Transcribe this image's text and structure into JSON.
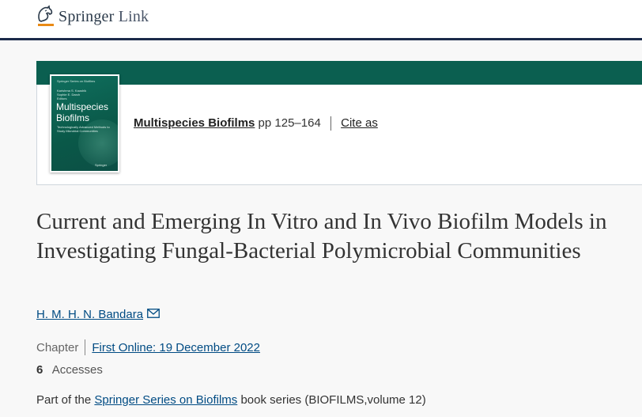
{
  "header": {
    "logo_word": "Springer",
    "logo_link": "Link",
    "logo_icon": "springer-horse-icon"
  },
  "book": {
    "cover": {
      "series": "Springer Series on Biofilms",
      "editors_line1": "Karishma S. Kaushik",
      "editors_line2": "Sophie E. Darch",
      "editors_role": "Editors",
      "title_line1": "Multispecies",
      "title_line2": "Biofilms",
      "subtitle": "Technologically Advanced Methods to Study Microbial Communities",
      "publisher": "Springer"
    },
    "title": "Multispecies Biofilms",
    "pages": "pp 125–164",
    "cite_label": "Cite as",
    "accent_color": "#0b5f50"
  },
  "chapter": {
    "title": "Current and Emerging In Vitro and In Vivo Biofilm Models in Investigating Fungal-Bacterial Polymicrobial Communities",
    "author": "H. M. H. N. Bandara",
    "author_icon": "mail-icon",
    "type": "Chapter",
    "first_online": "First Online: 19 December 2022",
    "accesses_count": "6",
    "accesses_label": "Accesses",
    "part_of_prefix": "Part of the ",
    "series_link": "Springer Series on Biofilms",
    "part_of_suffix": " book series (BIOFILMS,volume 12)"
  }
}
